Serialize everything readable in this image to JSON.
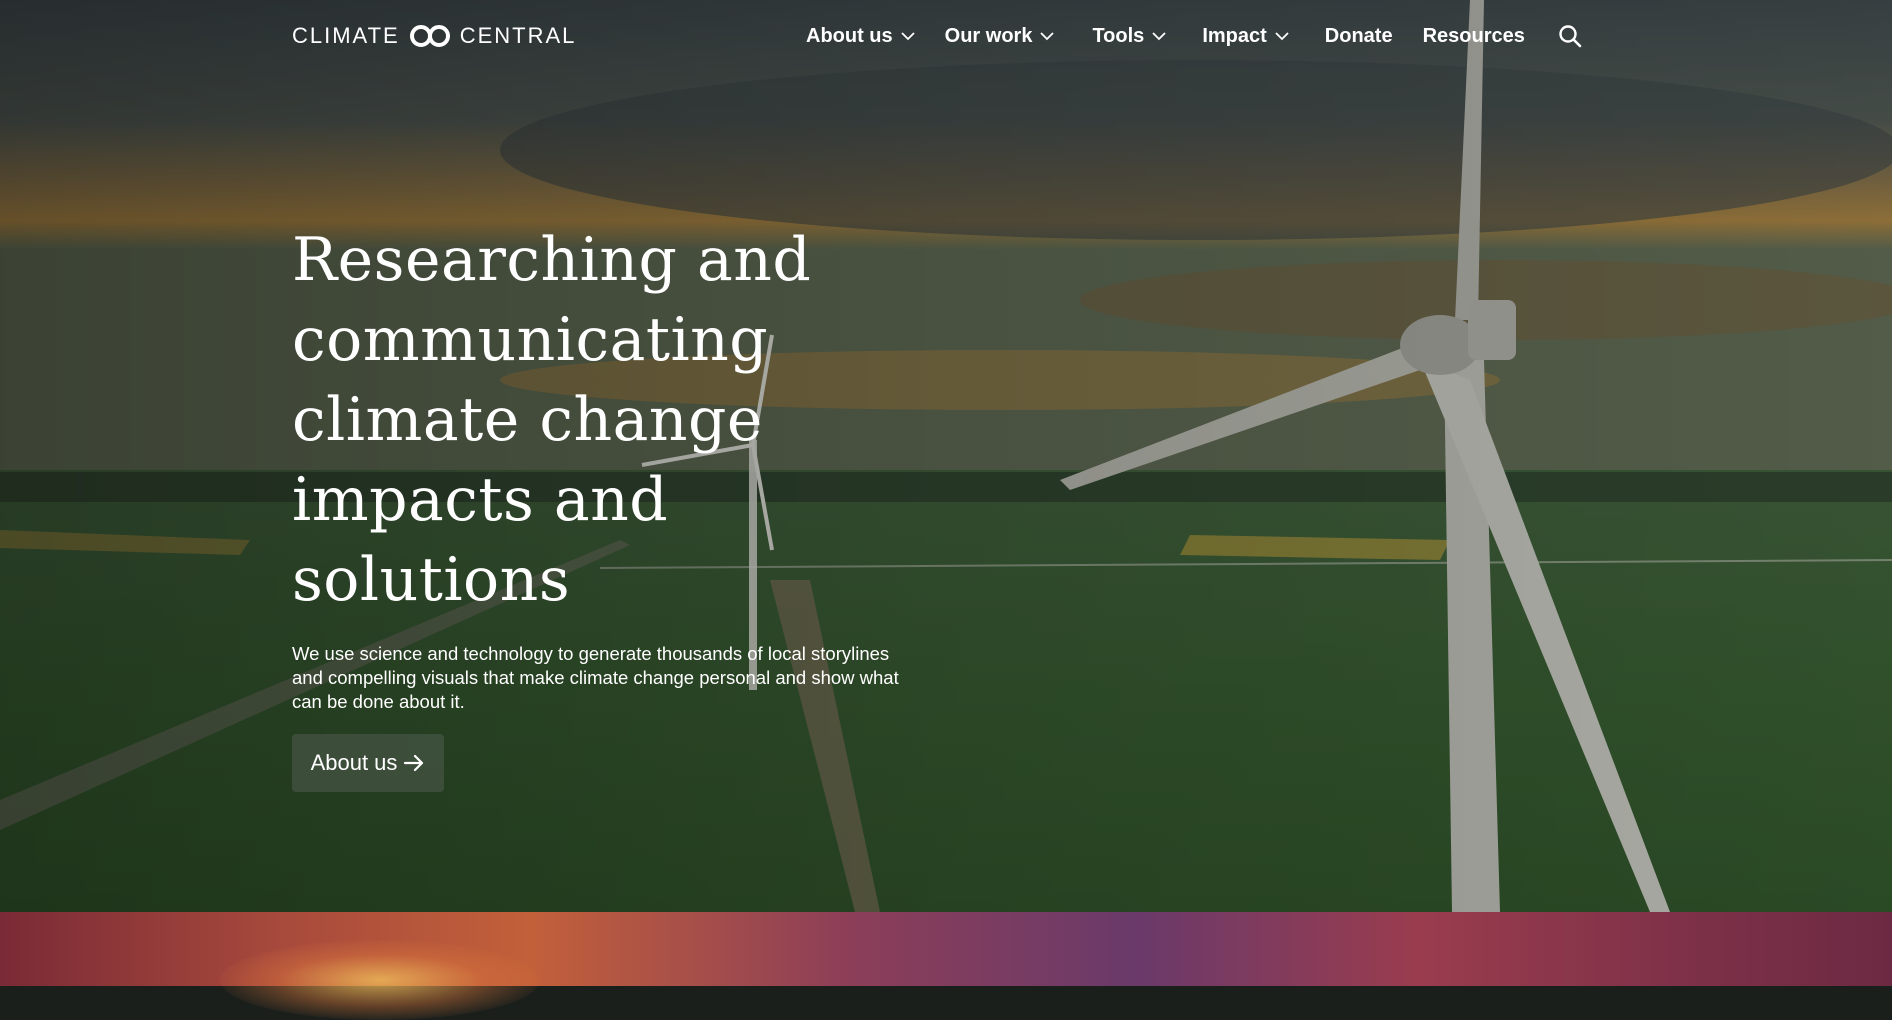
{
  "header": {
    "logo": {
      "word1": "CLIMATE",
      "word2": "CENTRAL",
      "icon": "linked-rings-logo-icon"
    },
    "nav": [
      {
        "label": "About us",
        "dropdown": true
      },
      {
        "label": "Our work",
        "dropdown": true
      },
      {
        "label": "Tools",
        "dropdown": true
      },
      {
        "label": "Impact",
        "dropdown": true
      },
      {
        "label": "Donate",
        "dropdown": false
      },
      {
        "label": "Resources",
        "dropdown": false
      }
    ],
    "search_icon": "search-icon"
  },
  "hero": {
    "headline": "Researching and communicating climate change impacts and solutions",
    "subtext": "We use science and technology to generate thousands of local storylines and compelling visuals that make climate change personal and show what can be done about it.",
    "cta_label": "About us",
    "cta_icon": "arrow-right-icon",
    "background": "aerial photo of wind turbines over green farm fields at sunset"
  },
  "colors": {
    "text": "#ffffff",
    "button_bg": "#505c50"
  }
}
